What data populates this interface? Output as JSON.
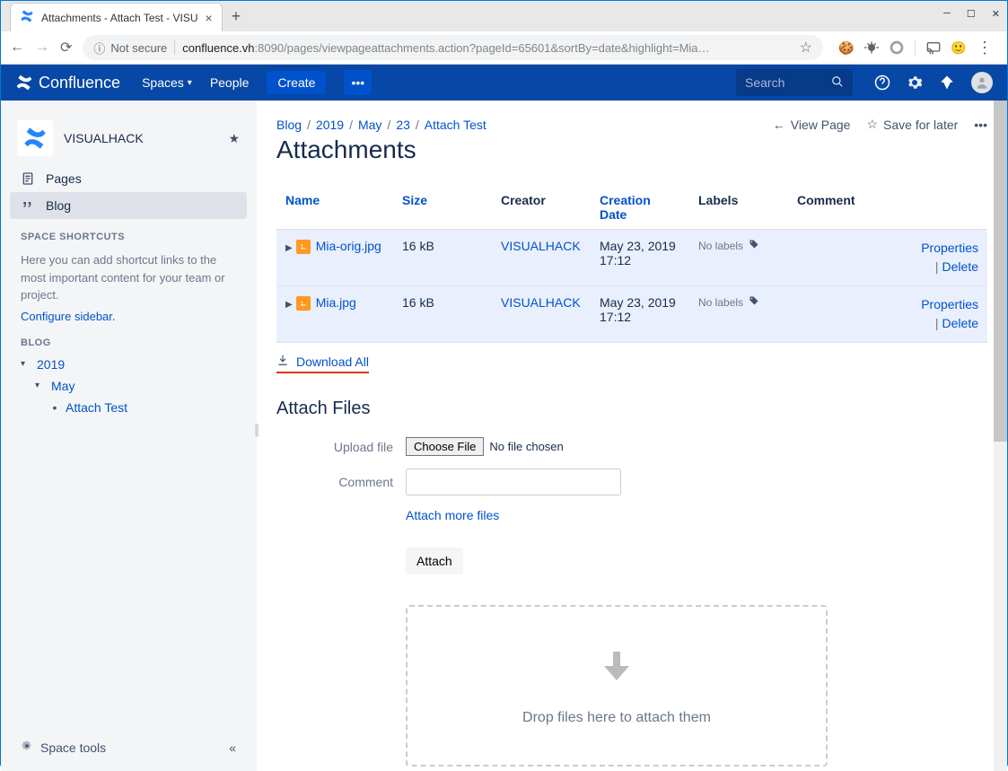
{
  "browser": {
    "tab_title": "Attachments - Attach Test - VISU",
    "insecure_label": "Not secure",
    "url_host": "confluence.vh",
    "url_port_path": ":8090/pages/viewpageattachments.action?pageId=65601&sortBy=date&highlight=Mia…"
  },
  "header": {
    "product": "Confluence",
    "nav_spaces": "Spaces",
    "nav_people": "People",
    "btn_create": "Create",
    "search_placeholder": "Search"
  },
  "sidebar": {
    "space_name": "VISUALHACK",
    "item_pages": "Pages",
    "item_blog": "Blog",
    "section_shortcuts": "SPACE SHORTCUTS",
    "shortcuts_help": "Here you can add shortcut links to the most important content for your team or project.",
    "configure_link": "Configure sidebar.",
    "section_blog": "BLOG",
    "tree": {
      "year": "2019",
      "month": "May",
      "leaf": "Attach Test"
    },
    "footer_tools": "Space tools"
  },
  "page": {
    "breadcrumb": [
      "Blog",
      "2019",
      "May",
      "23",
      "Attach Test"
    ],
    "action_view": "View Page",
    "action_save": "Save for later",
    "title": "Attachments"
  },
  "table": {
    "headers": {
      "name": "Name",
      "size": "Size",
      "creator": "Creator",
      "creation_date": "Creation Date",
      "labels": "Labels",
      "comment": "Comment"
    },
    "rows": [
      {
        "name": "Mia-orig.jpg",
        "size": "16 kB",
        "creator": "VISUALHACK",
        "date": "May 23, 2019 17:12",
        "labels": "No labels"
      },
      {
        "name": "Mia.jpg",
        "size": "16 kB",
        "creator": "VISUALHACK",
        "date": "May 23, 2019 17:12",
        "labels": "No labels"
      }
    ],
    "action_properties": "Properties",
    "action_delete": "Delete",
    "download_all": "Download All"
  },
  "attach": {
    "section_title": "Attach Files",
    "label_upload": "Upload file",
    "choose_file": "Choose File",
    "no_file": "No file chosen",
    "label_comment": "Comment",
    "attach_more": "Attach more files",
    "btn_attach": "Attach",
    "dropzone_text": "Drop files here to attach them"
  }
}
